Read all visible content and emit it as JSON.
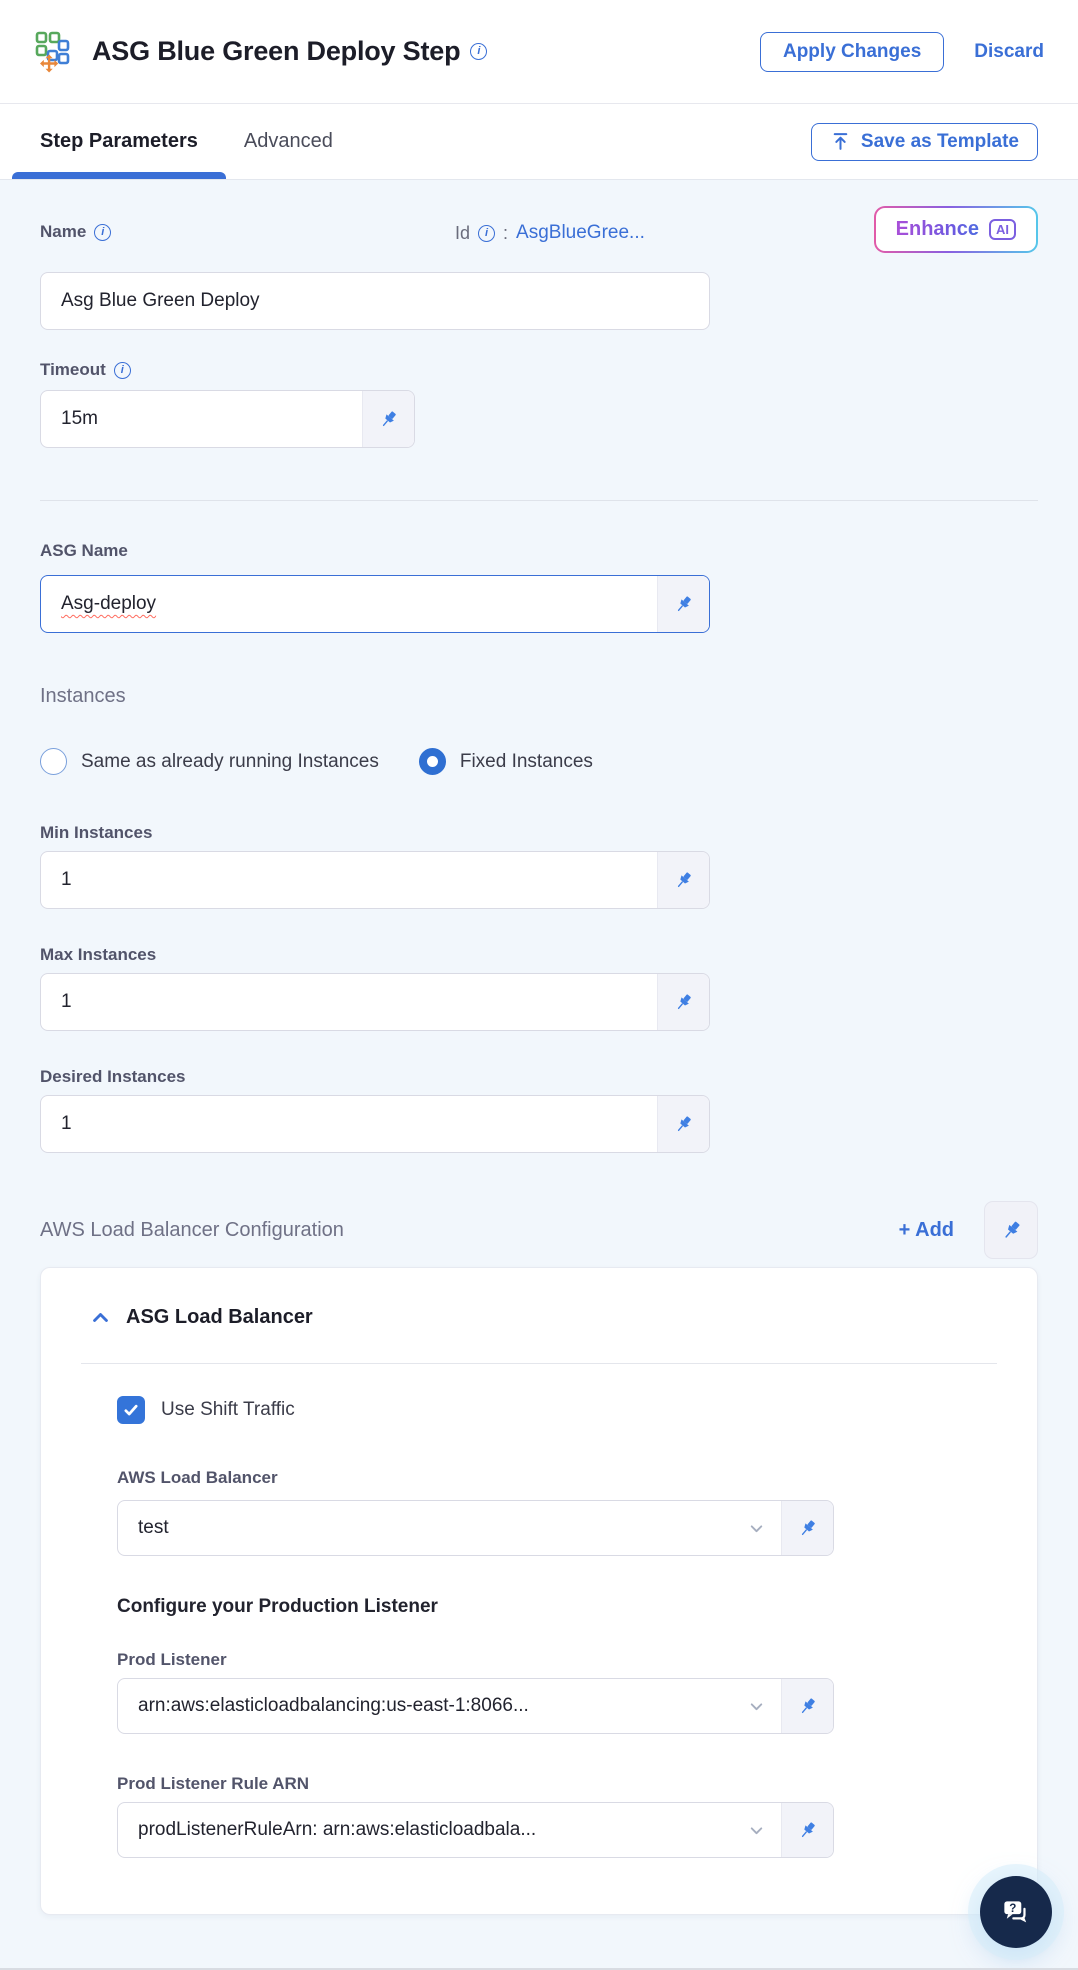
{
  "header": {
    "title": "ASG Blue Green Deploy Step",
    "apply_label": "Apply Changes",
    "discard_label": "Discard"
  },
  "tabs": {
    "step_parameters": "Step Parameters",
    "advanced": "Advanced",
    "save_as_template": "Save as Template"
  },
  "form": {
    "name": {
      "label": "Name",
      "value": "Asg Blue Green Deploy"
    },
    "id": {
      "label": "Id",
      "separator": ":",
      "value": "AsgBlueGree..."
    },
    "enhance": {
      "label": "Enhance",
      "badge": "AI"
    },
    "timeout": {
      "label": "Timeout",
      "value": "15m"
    },
    "asg_name": {
      "label": "ASG Name",
      "value": "Asg-deploy"
    },
    "instances": {
      "heading": "Instances",
      "radio_same_label": "Same as already running Instances",
      "radio_fixed_label": "Fixed Instances",
      "selected": "Fixed Instances"
    },
    "min_instances": {
      "label": "Min Instances",
      "value": "1"
    },
    "max_instances": {
      "label": "Max Instances",
      "value": "1"
    },
    "desired_instances": {
      "label": "Desired Instances",
      "value": "1"
    },
    "lb_config": {
      "heading": "AWS Load Balancer Configuration",
      "add_label": "+ Add"
    }
  },
  "card": {
    "title": "ASG Load Balancer",
    "use_shift_traffic_label": "Use Shift Traffic",
    "use_shift_traffic_checked": true,
    "aws_load_balancer": {
      "label": "AWS Load Balancer",
      "value": "test"
    },
    "configure_heading": "Configure your Production Listener",
    "prod_listener": {
      "label": "Prod Listener",
      "value": "arn:aws:elasticloadbalancing:us-east-1:8066..."
    },
    "prod_listener_rule": {
      "label": "Prod Listener Rule ARN",
      "value": "prodListenerRuleArn: arn:aws:elasticloadbala..."
    }
  },
  "colors": {
    "primary_blue": "#3a6fd6",
    "pin_blue": "#3f7fe3",
    "enhance_gradient": [
      "#e25ba8",
      "#8a5fe0",
      "#55c7ea"
    ],
    "enhance_text": "#7a4fd9",
    "checkbox_blue": "#3474d9",
    "radio_checked_blue": "#2f6fd2",
    "chat_fab_navy": "#16294b",
    "content_background": "#f2f7fc",
    "misspell_red": "#ff6b5e"
  }
}
